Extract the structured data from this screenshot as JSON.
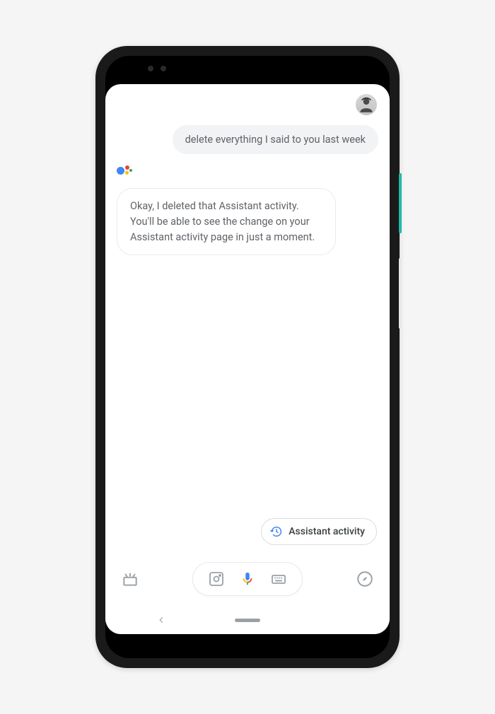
{
  "conversation": {
    "user_message": "delete everything I said to you last week",
    "assistant_message": "Okay, I deleted that Assistant activity. You'll be able to see the change on your Assistant activity page in just a moment."
  },
  "chip": {
    "label": "Assistant activity"
  },
  "icons": {
    "avatar": "user-avatar",
    "assistant_logo": "google-assistant-icon",
    "chip_icon": "history-icon",
    "discover": "discover-icon",
    "lens": "lens-icon",
    "mic": "mic-icon",
    "keyboard": "keyboard-icon",
    "compass": "compass-icon",
    "nav_back": "nav-back-icon",
    "nav_home": "nav-home-pill"
  },
  "colors": {
    "google_blue": "#4285f4",
    "google_red": "#ea4335",
    "google_yellow": "#fbbc04",
    "google_green": "#34a853",
    "bubble_bg": "#f1f3f4",
    "text_gray": "#5f6368"
  }
}
